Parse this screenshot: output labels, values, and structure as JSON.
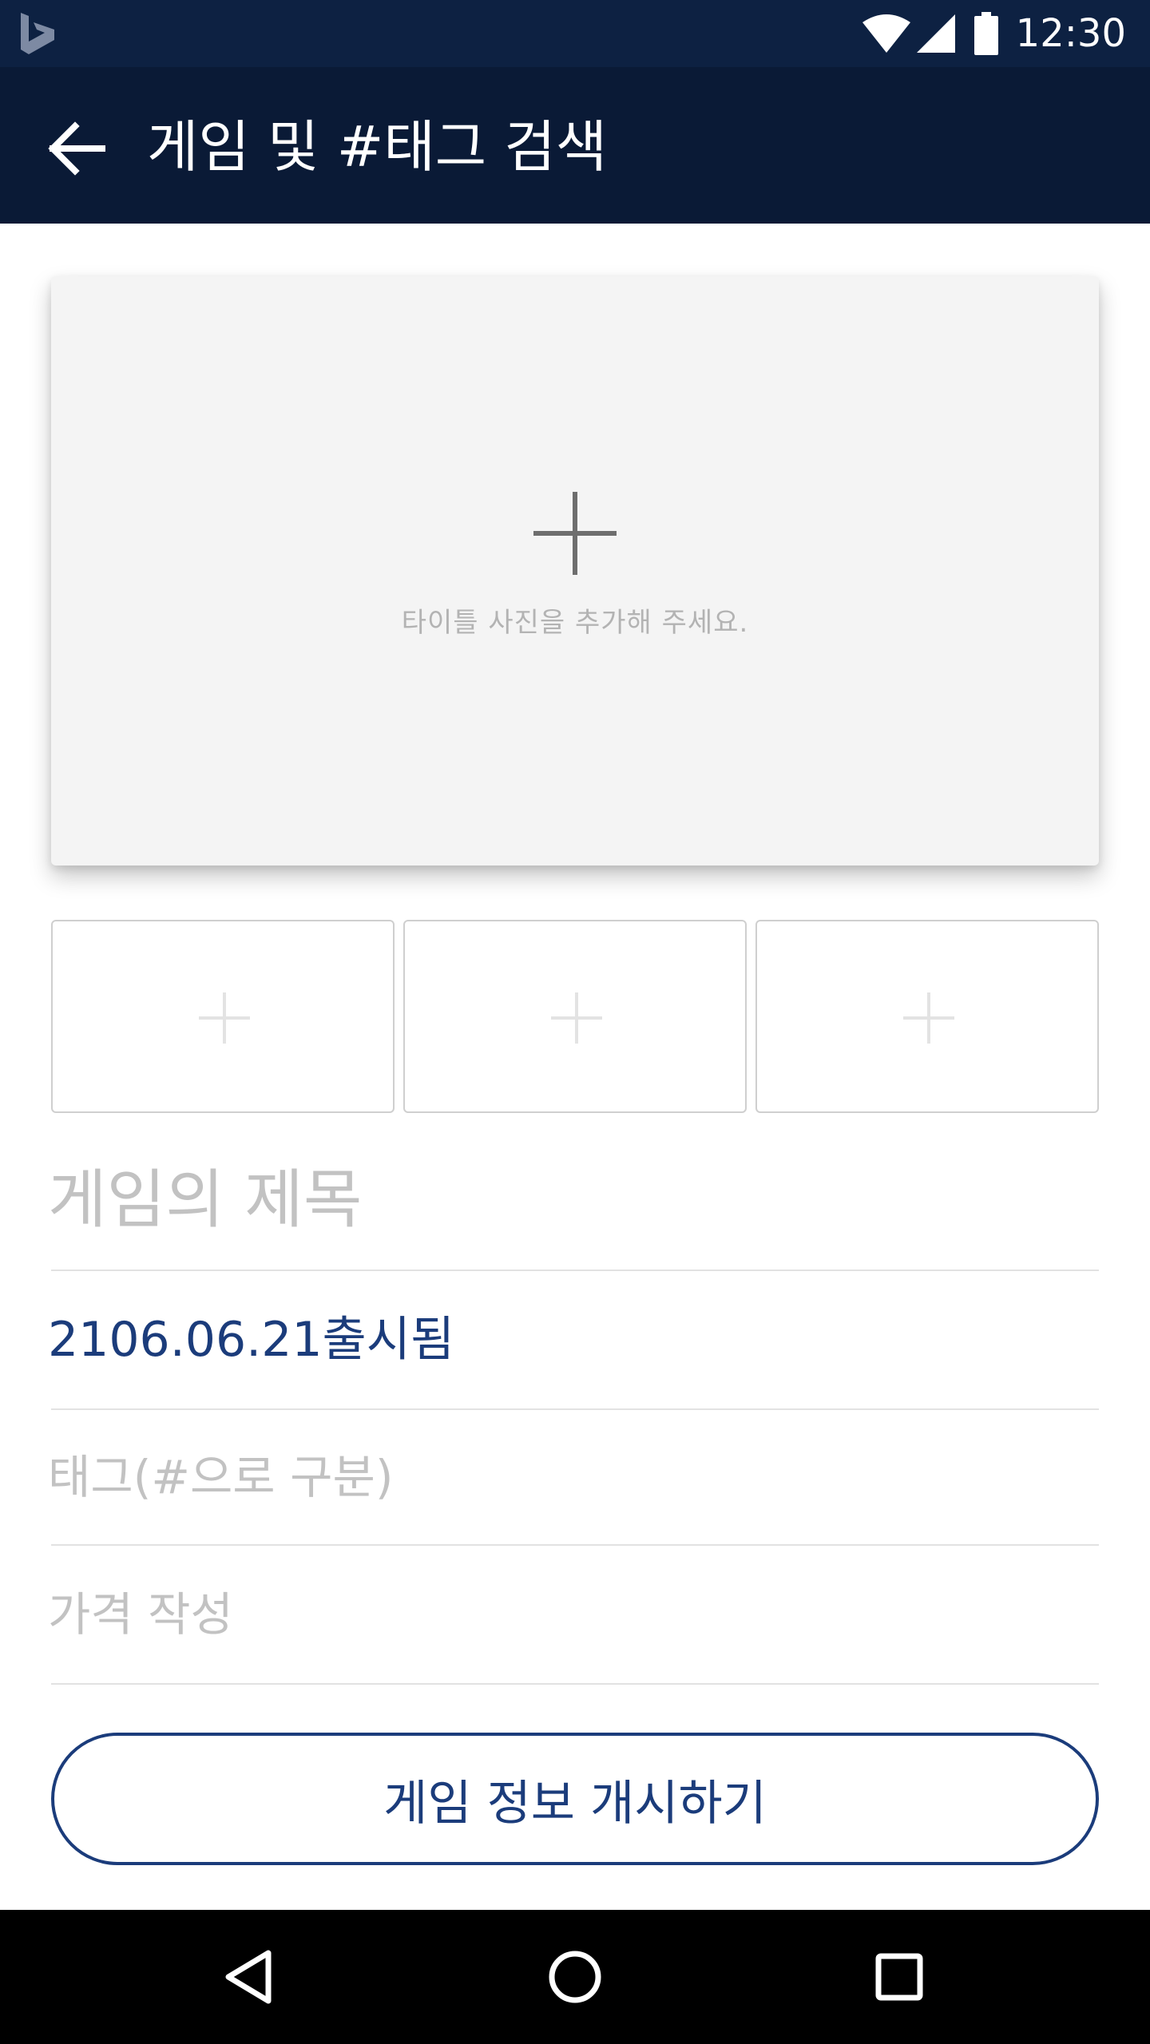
{
  "status_bar": {
    "time": "12:30",
    "icons": [
      "bing-logo-icon",
      "wifi-icon",
      "signal-icon",
      "battery-icon"
    ],
    "background": "#0d2142"
  },
  "app_bar": {
    "title": "게임 및 #태그 검색",
    "back_icon": "arrow-left-icon",
    "background": "#0a1a36"
  },
  "main_photo": {
    "hint": "타이틀 사진을 추가해 주세요.",
    "icon": "plus-icon"
  },
  "thumbnails": [
    {
      "icon": "plus-icon"
    },
    {
      "icon": "plus-icon"
    },
    {
      "icon": "plus-icon"
    }
  ],
  "form": {
    "title_placeholder": "게임의 제목",
    "release_date": "2106.06.21출시됨",
    "tags_placeholder": "태그(#으로 구분)",
    "price_placeholder": "가격 작성"
  },
  "publish_button": {
    "label": "게임 정보 개시하기",
    "color": "#1b3c7b"
  },
  "nav_bar": {
    "icons": [
      "triangle-back-icon",
      "circle-home-icon",
      "square-recents-icon"
    ]
  }
}
